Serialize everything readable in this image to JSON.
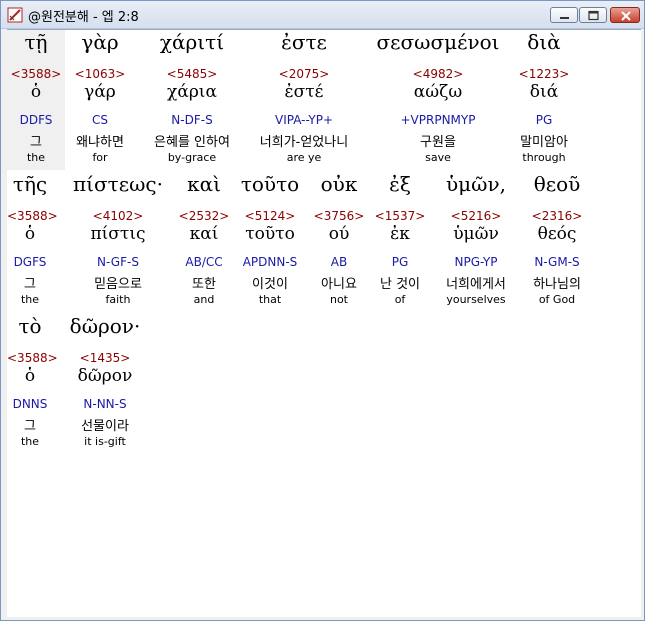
{
  "window": {
    "title": "@원전분해 - 엡 2:8"
  },
  "rows": [
    [
      {
        "greek": "τῇ",
        "strong": "<3588>",
        "lemma": "ὁ",
        "parse": "DDFS",
        "korean": "그",
        "english": "the"
      },
      {
        "greek": "γὰρ",
        "strong": "<1063>",
        "lemma": "γάρ",
        "parse": "CS",
        "korean": "왜냐하면",
        "english": "for"
      },
      {
        "greek": "χάριτί",
        "strong": "<5485>",
        "lemma": "χάρια",
        "parse": "N-DF-S",
        "korean": "은혜를 인하여",
        "english": "by-grace"
      },
      {
        "greek": "ἐστε",
        "strong": "<2075>",
        "lemma": "ἐστέ",
        "parse": "VIPA--YP+",
        "korean": "너희가-얻었나니",
        "english": "are ye"
      },
      {
        "greek": "σεσωσμένοι",
        "strong": "<4982>",
        "lemma": "αώζω",
        "parse": "+VPRPNMYP",
        "korean": "구원을",
        "english": "save"
      },
      {
        "greek": "διὰ",
        "strong": "<1223>",
        "lemma": "διά",
        "parse": "PG",
        "korean": "말미암아",
        "english": "through"
      }
    ],
    [
      {
        "greek": "τῆς",
        "strong": "<3588>",
        "lemma": "ὁ",
        "parse": "DGFS",
        "korean": "그",
        "english": "the"
      },
      {
        "greek": "πίστεως·",
        "strong": "<4102>",
        "lemma": "πίστις",
        "parse": "N-GF-S",
        "korean": "믿음으로",
        "english": "faith"
      },
      {
        "greek": "καὶ",
        "strong": "<2532>",
        "lemma": "καί",
        "parse": "AB/CC",
        "korean": "또한",
        "english": "and"
      },
      {
        "greek": "τοῦτο",
        "strong": "<5124>",
        "lemma": "τοῦτο",
        "parse": "APDNN-S",
        "korean": "이것이",
        "english": "that"
      },
      {
        "greek": "οὐκ",
        "strong": "<3756>",
        "lemma": "ού",
        "parse": "AB",
        "korean": "아니요",
        "english": "not"
      },
      {
        "greek": "ἐξ",
        "strong": "<1537>",
        "lemma": "ἐκ",
        "parse": "PG",
        "korean": "난 것이",
        "english": "of"
      },
      {
        "greek": "ὑμῶν,",
        "strong": "<5216>",
        "lemma": "ὑμῶν",
        "parse": "NPG-YP",
        "korean": "너희에게서",
        "english": "yourselves"
      },
      {
        "greek": "θεοῦ",
        "strong": "<2316>",
        "lemma": "θεός",
        "parse": "N-GM-S",
        "korean": "하나님의",
        "english": "of God"
      }
    ],
    [
      {
        "greek": "τὸ",
        "strong": "<3588>",
        "lemma": "ὁ",
        "parse": "DNNS",
        "korean": "그",
        "english": "the"
      },
      {
        "greek": "δῶρον·",
        "strong": "<1435>",
        "lemma": "δῶρον",
        "parse": "N-NN-S",
        "korean": "선물이라",
        "english": "it is-gift"
      }
    ]
  ]
}
